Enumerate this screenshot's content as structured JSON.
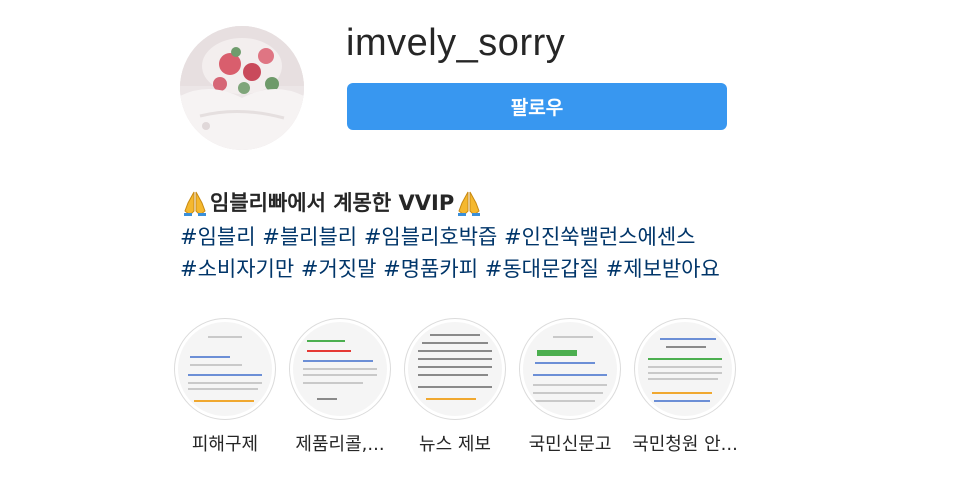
{
  "profile": {
    "username": "imvely_sorry",
    "follow_label": "팔로우"
  },
  "bio": {
    "title": "임블리빠에서 계몽한 VVIP",
    "title_emoji": "folded-hands-icon",
    "hashtags": [
      "#임블리",
      "#블리블리",
      "#임블리호박즙",
      "#인진쑥밸런스에센스",
      "#소비자기만",
      "#거짓말",
      "#명품카피",
      "#동대문갑질",
      "#제보받아요"
    ]
  },
  "highlights": [
    {
      "label": "피해구제"
    },
    {
      "label": "제품리콜,..."
    },
    {
      "label": "뉴스 제보"
    },
    {
      "label": "국민신문고"
    },
    {
      "label": "국민청원 안..."
    }
  ],
  "colors": {
    "follow_button": "#3897f0",
    "hashtag": "#003569",
    "text": "#262626"
  }
}
